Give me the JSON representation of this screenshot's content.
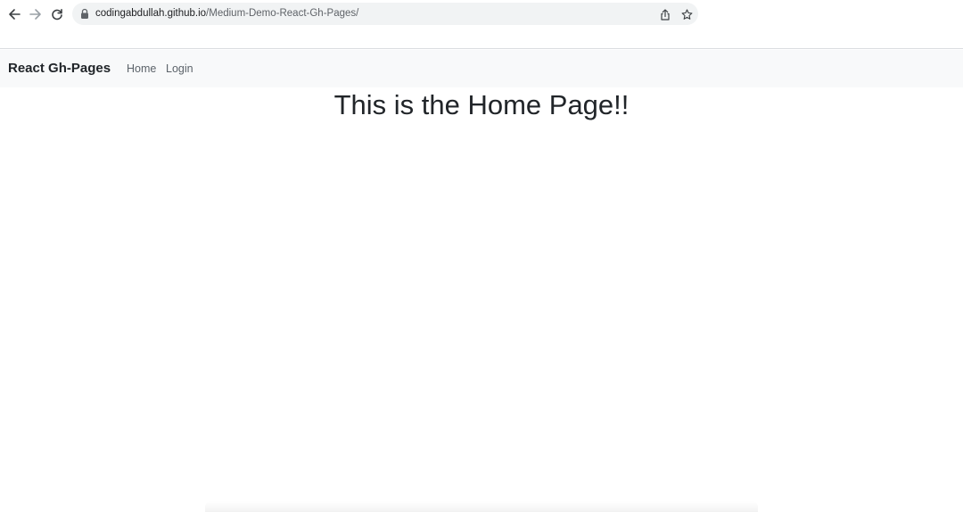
{
  "browser": {
    "url_host": "codingabdullah.github.io",
    "url_path": "/Medium-Demo-React-Gh-Pages/",
    "icons": {
      "back": "arrow-left-icon",
      "forward": "arrow-right-icon",
      "reload": "reload-icon",
      "lock": "lock-icon",
      "share": "share-icon",
      "bookmark": "star-icon"
    }
  },
  "navbar": {
    "brand": "React Gh-Pages",
    "links": [
      {
        "label": "Home"
      },
      {
        "label": "Login"
      }
    ]
  },
  "main": {
    "heading": "This is the Home Page!!"
  },
  "colors": {
    "navbar_bg": "#f8f9fa",
    "omnibox_bg": "#f1f3f4",
    "text": "#212529",
    "link": "#5c636a"
  }
}
